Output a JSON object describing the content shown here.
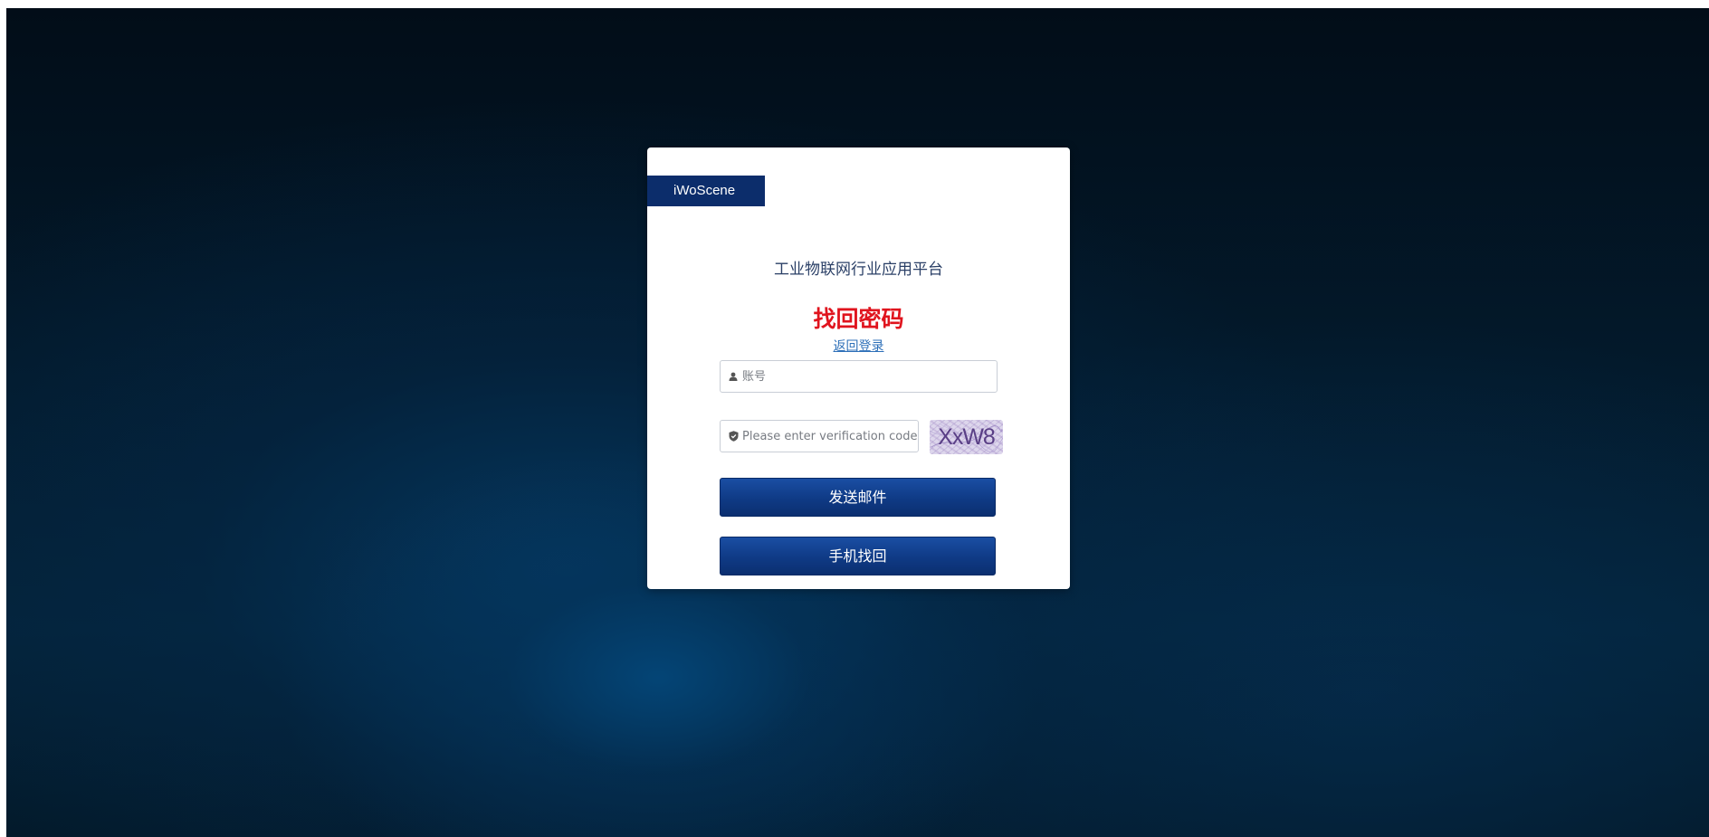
{
  "card": {
    "brand": "iWoScene",
    "platform_title": "工业物联网行业应用平台",
    "heading": "找回密码",
    "back_link": "返回登录"
  },
  "form": {
    "account": {
      "icon": "user-icon",
      "placeholder": "账号",
      "value": ""
    },
    "verification": {
      "icon": "shield-icon",
      "placeholder": "Please enter verification code",
      "value": ""
    },
    "captcha_text": "XxW8"
  },
  "buttons": {
    "send_email": "发送邮件",
    "phone_recover": "手机找回"
  },
  "colors": {
    "brand_bar": "#0c2d6b",
    "heading": "#e0141e",
    "link": "#2d6fb8",
    "button": "#0f3a85"
  }
}
